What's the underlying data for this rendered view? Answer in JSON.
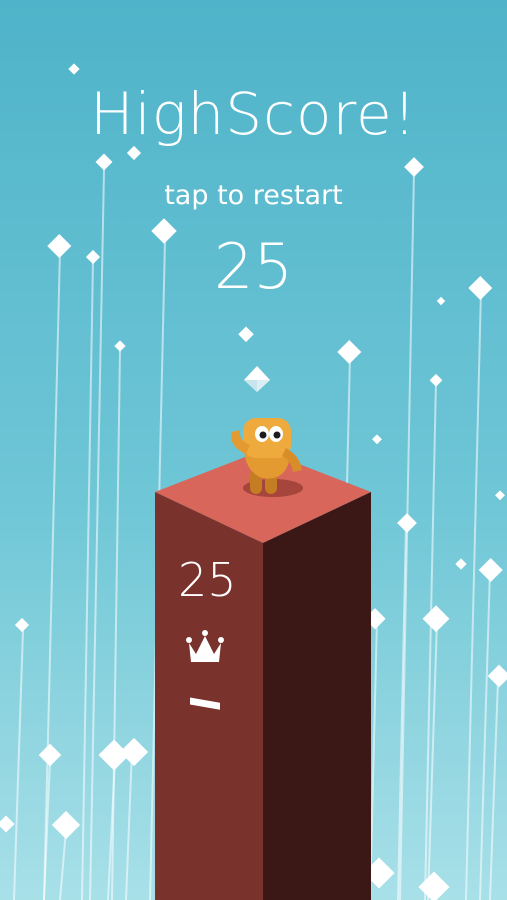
{
  "hud": {
    "headline": "HighScore!",
    "restart_prompt": "tap to restart",
    "score": "25"
  },
  "pillar": {
    "number": "25",
    "badge_icon": "crown-icon"
  },
  "colors": {
    "sky_top": "#4fb3c9",
    "sky_bottom": "#a8e0e8",
    "pillar_top": "#d9665a",
    "pillar_left": "#7a332c",
    "pillar_right": "#3a1714",
    "character": "#e8a23a"
  }
}
